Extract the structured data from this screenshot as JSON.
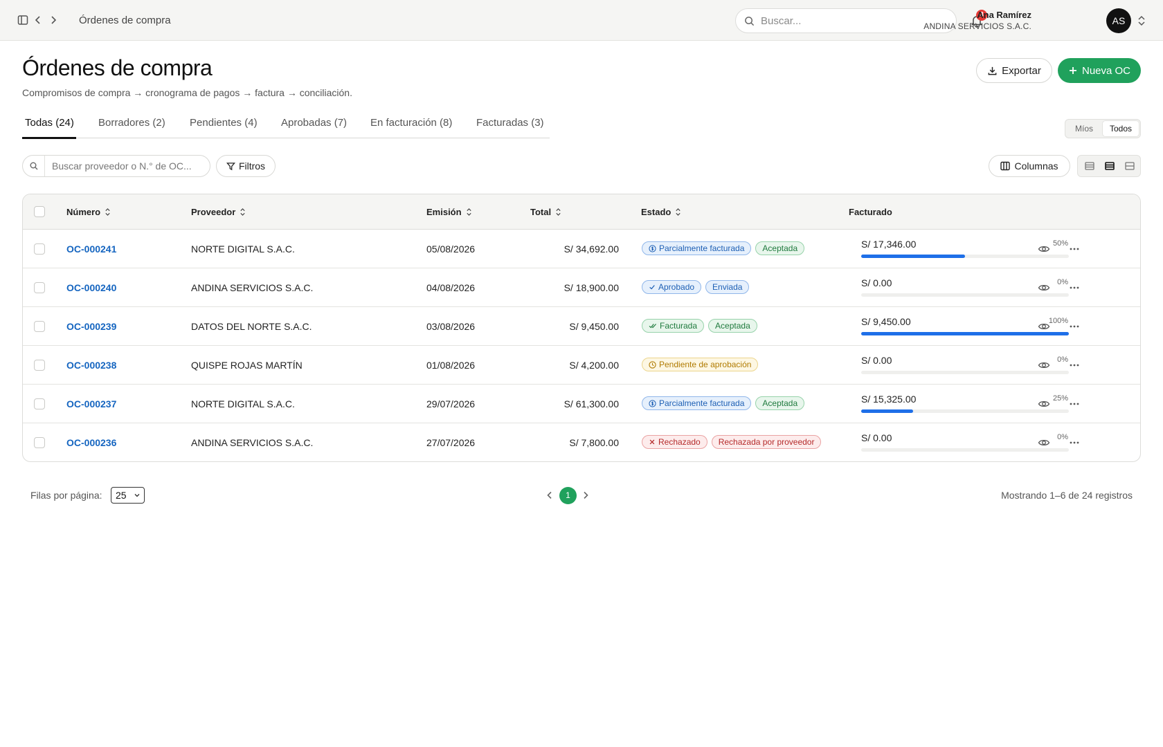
{
  "topbar": {
    "breadcrumb": "Órdenes de compra",
    "search_placeholder": "Buscar...",
    "notification_count": "3",
    "user_name": "Ana Ramírez",
    "user_org": "ANDINA SERVICIOS S.A.C.",
    "avatar_initials": "AS",
    "icons": [
      "sidebar-toggle-icon",
      "chevron-left-icon",
      "chevron-right-icon",
      "search-icon",
      "bell-icon",
      "chevron-updown-icon"
    ]
  },
  "header": {
    "title": "Órdenes de compra",
    "subtitle": "Compromisos de compra → cronograma de pagos → factura → conciliación.",
    "export_label": "Exportar",
    "new_label": "Nueva OC",
    "accent_color": "#20a15c"
  },
  "tabs": [
    {
      "label": "Todas (24)",
      "active": true
    },
    {
      "label": "Borradores (2)"
    },
    {
      "label": "Pendientes (4)"
    },
    {
      "label": "Aprobadas (7)"
    },
    {
      "label": "En facturación (8)"
    },
    {
      "label": "Facturadas (3)"
    }
  ],
  "scope_toggle": {
    "options": [
      "Míos",
      "Todos"
    ],
    "selected": "Todos"
  },
  "toolbar": {
    "search_placeholder": "Buscar proveedor o N.° de OC...",
    "filters_label": "Filtros",
    "columns_label": "Columnas",
    "density_selected": "medium"
  },
  "table": {
    "columns": {
      "numero": "Número",
      "proveedor": "Proveedor",
      "emision": "Emisión",
      "total": "Total",
      "estado": "Estado",
      "facturado": "Facturado"
    },
    "rows": [
      {
        "numero": "OC-000241",
        "proveedor": "NORTE DIGITAL S.A.C.",
        "emision": "05/08/2026",
        "total": "S/ 34,692.00",
        "badges": [
          {
            "label": "Parcialmente facturada",
            "tone": "blue",
            "icon": "dollar-circle-icon"
          },
          {
            "label": "Aceptada",
            "tone": "green"
          }
        ],
        "facturado": "S/ 17,346.00",
        "pct_label": "50%",
        "pct": 50
      },
      {
        "numero": "OC-000240",
        "proveedor": "ANDINA SERVICIOS S.A.C.",
        "emision": "04/08/2026",
        "total": "S/ 18,900.00",
        "badges": [
          {
            "label": "Aprobado",
            "tone": "blue",
            "icon": "check-icon"
          },
          {
            "label": "Enviada",
            "tone": "blue"
          }
        ],
        "facturado": "S/ 0.00",
        "pct_label": "0%",
        "pct": 0
      },
      {
        "numero": "OC-000239",
        "proveedor": "DATOS DEL NORTE S.A.C.",
        "emision": "03/08/2026",
        "total": "S/ 9,450.00",
        "badges": [
          {
            "label": "Facturada",
            "tone": "green",
            "icon": "double-check-icon"
          },
          {
            "label": "Aceptada",
            "tone": "green"
          }
        ],
        "facturado": "S/ 9,450.00",
        "pct_label": "100%",
        "pct": 100
      },
      {
        "numero": "OC-000238",
        "proveedor": "QUISPE ROJAS MARTÍN",
        "emision": "01/08/2026",
        "total": "S/ 4,200.00",
        "badges": [
          {
            "label": "Pendiente de aprobación",
            "tone": "yellow",
            "icon": "clock-icon"
          }
        ],
        "facturado": "S/ 0.00",
        "pct_label": "0%",
        "pct": 0
      },
      {
        "numero": "OC-000237",
        "proveedor": "NORTE DIGITAL S.A.C.",
        "emision": "29/07/2026",
        "total": "S/ 61,300.00",
        "badges": [
          {
            "label": "Parcialmente facturada",
            "tone": "blue",
            "icon": "dollar-circle-icon"
          },
          {
            "label": "Aceptada",
            "tone": "green"
          }
        ],
        "facturado": "S/ 15,325.00",
        "pct_label": "25%",
        "pct": 25
      },
      {
        "numero": "OC-000236",
        "proveedor": "ANDINA SERVICIOS S.A.C.",
        "emision": "27/07/2026",
        "total": "S/ 7,800.00",
        "badges": [
          {
            "label": "Rechazado",
            "tone": "red",
            "icon": "x-icon"
          },
          {
            "label": "Rechazada por proveedor",
            "tone": "red"
          }
        ],
        "facturado": "S/ 0.00",
        "pct_label": "0%",
        "pct": 0
      }
    ]
  },
  "pagination": {
    "rows_label": "Filas por página:",
    "rows_per_page": "25",
    "current_page": "1",
    "info": "Mostrando 1–6 de 24 registros"
  }
}
